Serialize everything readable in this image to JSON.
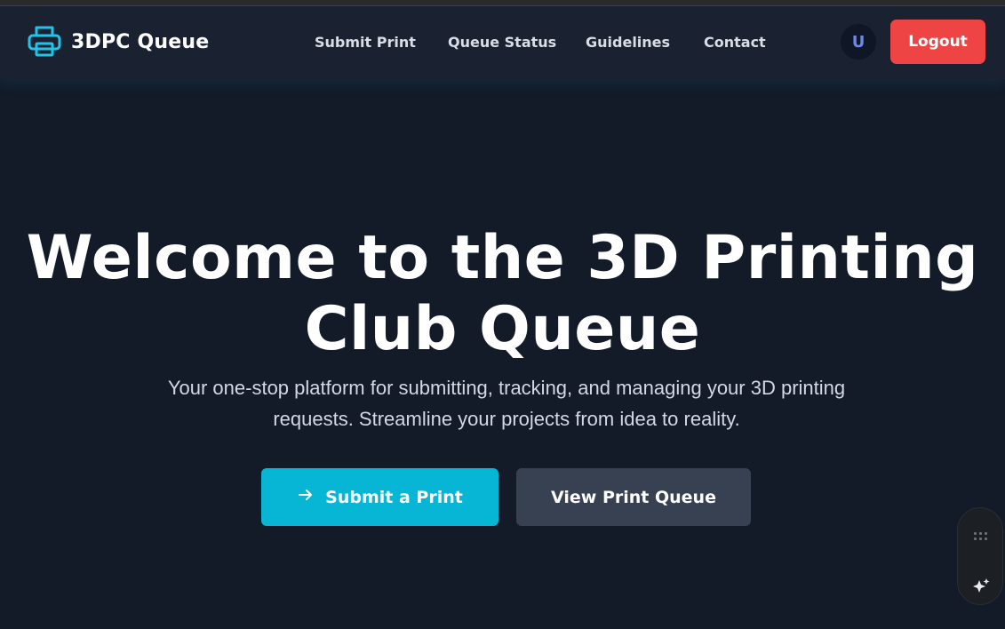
{
  "brand": {
    "name": "3DPC Queue",
    "icon": "printer-icon"
  },
  "nav": {
    "links": [
      {
        "label": "Submit Print"
      },
      {
        "label": "Queue Status"
      },
      {
        "label": "Guidelines"
      },
      {
        "label": "Contact"
      }
    ]
  },
  "user": {
    "avatar_initial": "U",
    "logout_label": "Logout"
  },
  "hero": {
    "title_line1": "Welcome to the 3D Printing",
    "title_line2": "Club Queue",
    "subtitle_line1": "Your one-stop platform for submitting, tracking, and managing your 3D printing",
    "subtitle_line2": "requests. Streamline your projects from idea to reality.",
    "primary_button": {
      "label": "Submit a Print",
      "icon": "arrow-right-icon"
    },
    "secondary_button": {
      "label": "View Print Queue"
    }
  },
  "floating_panel": {
    "icons": [
      "grid-dots-icon",
      "sparkle-icon"
    ]
  },
  "colors": {
    "background": "#131a28",
    "navbar": "#1a2232",
    "accent": "#06b6d4",
    "danger": "#ef4444",
    "secondary": "#374151"
  }
}
